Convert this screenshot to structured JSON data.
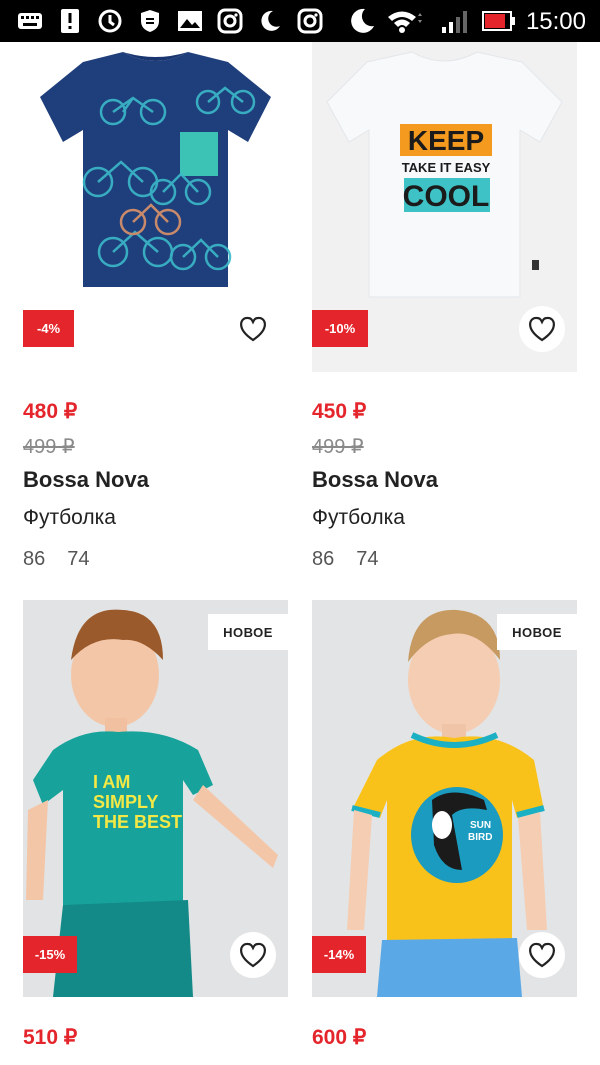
{
  "status_bar": {
    "time": "15:00",
    "icons": [
      "keyboard-icon",
      "alert-icon",
      "sync-icon",
      "shield-app-icon",
      "gallery-icon",
      "instagram-icon",
      "night-mode-icon",
      "instagram-icon",
      "night-mode-icon",
      "wifi-icon",
      "signal-icon",
      "battery-icon"
    ]
  },
  "products": [
    {
      "discount": "-4%",
      "price": "480 ₽",
      "old_price": "499 ₽",
      "brand": "Bossa Nova",
      "type": "Футболка",
      "sizes": [
        "86",
        "74"
      ]
    },
    {
      "discount": "-10%",
      "price": "450 ₽",
      "old_price": "499 ₽",
      "brand": "Bossa Nova",
      "type": "Футболка",
      "sizes": [
        "86",
        "74"
      ],
      "print_text": [
        "KEEP",
        "TAKE IT EASY",
        "COOL"
      ]
    },
    {
      "badge": "НОВОЕ",
      "discount": "-15%",
      "price": "510 ₽",
      "print_text": [
        "I AM",
        "SIMPLY",
        "THE BEST"
      ]
    },
    {
      "badge": "НОВОЕ",
      "discount": "-14%",
      "price": "600 ₽",
      "print_text": [
        "SUN",
        "BIRD"
      ]
    }
  ],
  "colors": {
    "accent": "#e4252b",
    "text": "#222222",
    "muted": "#8a8a8a"
  }
}
